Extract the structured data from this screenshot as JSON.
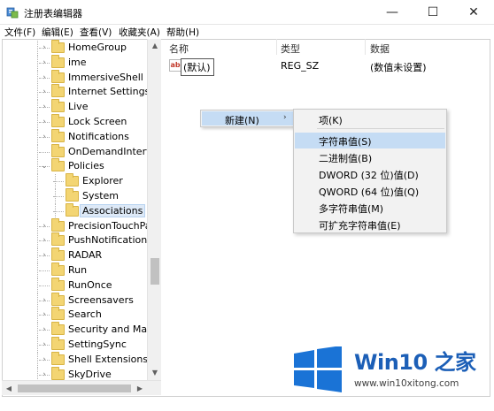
{
  "window": {
    "title": "注册表编辑器",
    "minimize_glyph": "—",
    "maximize_glyph": "☐",
    "close_glyph": "✕"
  },
  "menubar": [
    "文件(F)",
    "编辑(E)",
    "查看(V)",
    "收藏夹(A)",
    "帮助(H)"
  ],
  "tree": [
    {
      "label": "HomeGroup",
      "expander": "›",
      "selected": false
    },
    {
      "label": "ime",
      "expander": "›",
      "selected": false
    },
    {
      "label": "ImmersiveShell",
      "expander": "›",
      "selected": false
    },
    {
      "label": "Internet Settings",
      "expander": "›",
      "selected": false
    },
    {
      "label": "Live",
      "expander": "›",
      "selected": false
    },
    {
      "label": "Lock Screen",
      "expander": "›",
      "selected": false
    },
    {
      "label": "Notifications",
      "expander": "›",
      "selected": false
    },
    {
      "label": "OnDemandInterfac",
      "expander": "",
      "selected": false
    },
    {
      "label": "Policies",
      "expander": "⌄",
      "selected": false
    },
    {
      "label": "Explorer",
      "expander": "",
      "selected": false,
      "child": true
    },
    {
      "label": "System",
      "expander": "",
      "selected": false,
      "child": true
    },
    {
      "label": "Associations",
      "expander": "",
      "selected": true,
      "child": true
    },
    {
      "label": "PrecisionTouchPac",
      "expander": "›",
      "selected": false
    },
    {
      "label": "PushNotifications",
      "expander": "›",
      "selected": false
    },
    {
      "label": "RADAR",
      "expander": "›",
      "selected": false
    },
    {
      "label": "Run",
      "expander": "",
      "selected": false
    },
    {
      "label": "RunOnce",
      "expander": "",
      "selected": false
    },
    {
      "label": "Screensavers",
      "expander": "›",
      "selected": false
    },
    {
      "label": "Search",
      "expander": "›",
      "selected": false
    },
    {
      "label": "Security and Maint",
      "expander": "›",
      "selected": false
    },
    {
      "label": "SettingSync",
      "expander": "›",
      "selected": false
    },
    {
      "label": "Shell Extensions",
      "expander": "›",
      "selected": false
    },
    {
      "label": "SkyDrive",
      "expander": "›",
      "selected": false
    }
  ],
  "list": {
    "columns": {
      "name": "名称",
      "type": "类型",
      "data": "数据"
    },
    "rows": [
      {
        "icon": "ab",
        "name": "(默认)",
        "type": "REG_SZ",
        "data": "(数值未设置)"
      }
    ]
  },
  "context_menu": {
    "item_label": "新建(N)",
    "submenu_arrow": "›",
    "submenu": [
      {
        "label": "项(K)",
        "highlight": false
      },
      {
        "label": "字符串值(S)",
        "highlight": true
      },
      {
        "label": "二进制值(B)",
        "highlight": false
      },
      {
        "label": "DWORD (32 位)值(D)",
        "highlight": false
      },
      {
        "label": "QWORD (64 位)值(Q)",
        "highlight": false
      },
      {
        "label": "多字符串值(M)",
        "highlight": false
      },
      {
        "label": "可扩充字符串值(E)",
        "highlight": false
      }
    ]
  },
  "watermark": {
    "brand": "Win10 之家",
    "url": "www.win10xitong.com",
    "colors": {
      "blue": "#1c5fb7",
      "tile": "#1a73d6"
    }
  },
  "colors": {
    "highlight": "#c5dcf4",
    "folder": "#f3d573"
  }
}
